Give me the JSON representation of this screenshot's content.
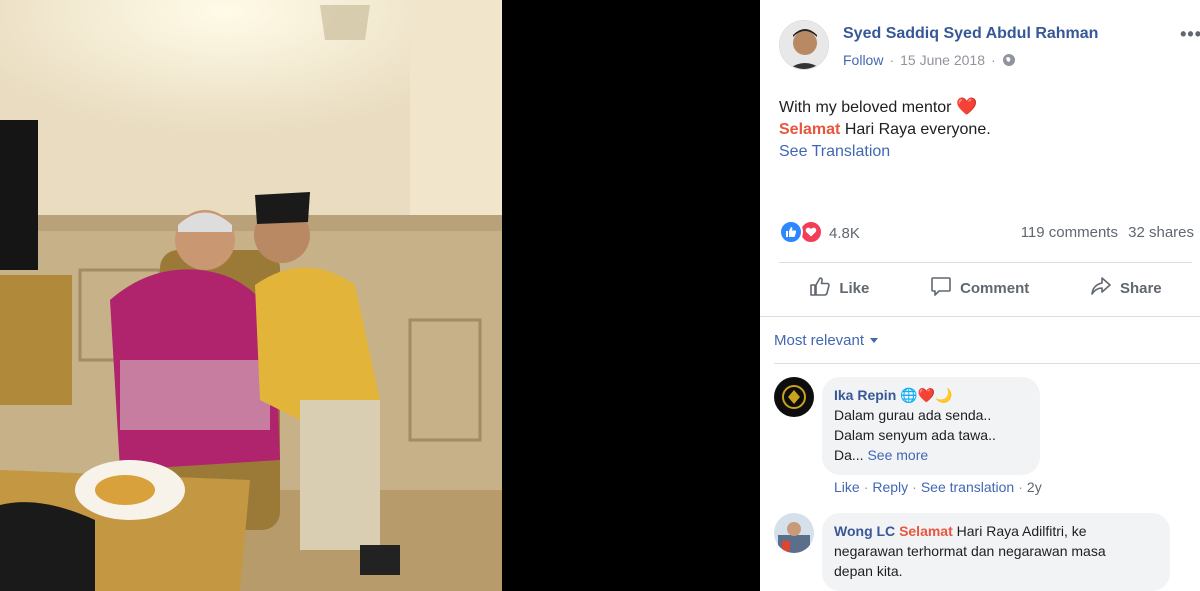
{
  "post": {
    "author": "Syed Saddiq Syed Abdul Rahman",
    "follow_label": "Follow",
    "separator": "·",
    "date": "15 June 2018",
    "text_line1": "With my beloved mentor",
    "highlight_word": "Selamat",
    "text_line2_rest": "Hari Raya everyone.",
    "see_translation": "See Translation"
  },
  "stats": {
    "reaction_count": "4.8K",
    "comments": "119 comments",
    "shares": "32 shares"
  },
  "actions": {
    "like": "Like",
    "comment": "Comment",
    "share": "Share"
  },
  "sort": {
    "label": "Most relevant"
  },
  "comments": [
    {
      "name": "Ika Repin",
      "emoji": "🌐❤️🌙",
      "line1": "Dalam gurau ada senda..",
      "line2": "Dalam senyum ada tawa..",
      "line3": "Da...",
      "see_more": "See more",
      "like": "Like",
      "reply": "Reply",
      "see_translation": "See translation",
      "age": "2y"
    },
    {
      "name": "Wong LC",
      "highlight": "Selamat",
      "text_line1_rest": "Hari Raya Adilfitri, ke",
      "line2": "negarawan terhormat dan negarawan masa",
      "line3": "depan kita."
    }
  ],
  "colors": {
    "link": "#4267b2",
    "name": "#365899",
    "highlight": "#e9553d",
    "like_reaction": "#2d88ff",
    "love_reaction": "#f33e58"
  }
}
